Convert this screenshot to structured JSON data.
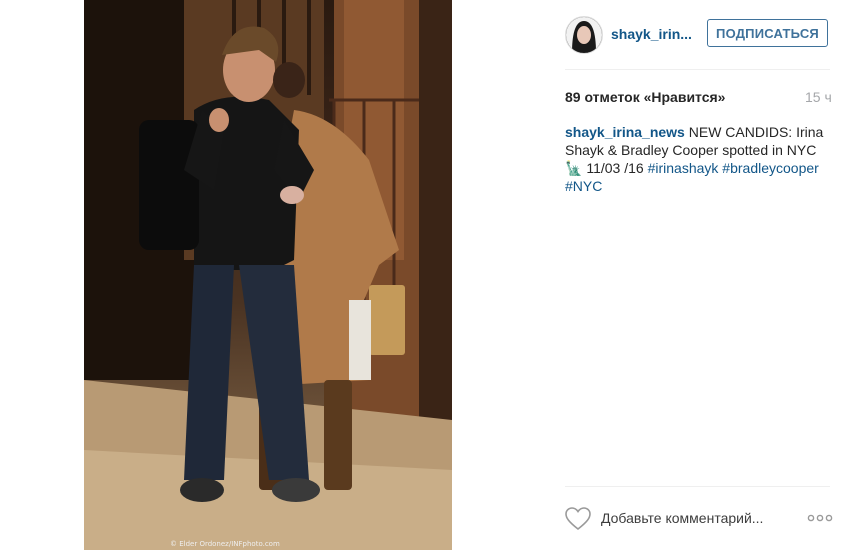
{
  "post": {
    "photo_credit": "© Elder Ordonez/INFphoto.com",
    "header": {
      "username": "shayk_irin...",
      "follow_label": "ПОДПИСАТЬСЯ"
    },
    "likes_text": "89 отметок «Нравится»",
    "time_text": "15 ч",
    "caption": {
      "author": "shayk_irina_news",
      "text_line": " NEW CANDIDS: Irina Shayk & Bradley Cooper spotted in NYC ",
      "emoji": "🗽",
      "date": " 11/03 /16 ",
      "hashtags": [
        "#irinashayk",
        "#bradleycooper",
        "#NYC"
      ]
    },
    "comment_placeholder": "Добавьте комментарий...",
    "icons": {
      "like": "heart-icon",
      "more": "more-options-icon",
      "avatar": "avatar"
    },
    "colors": {
      "link": "#125688",
      "follow": "#3f729b",
      "time": "#a5a7aa"
    }
  }
}
